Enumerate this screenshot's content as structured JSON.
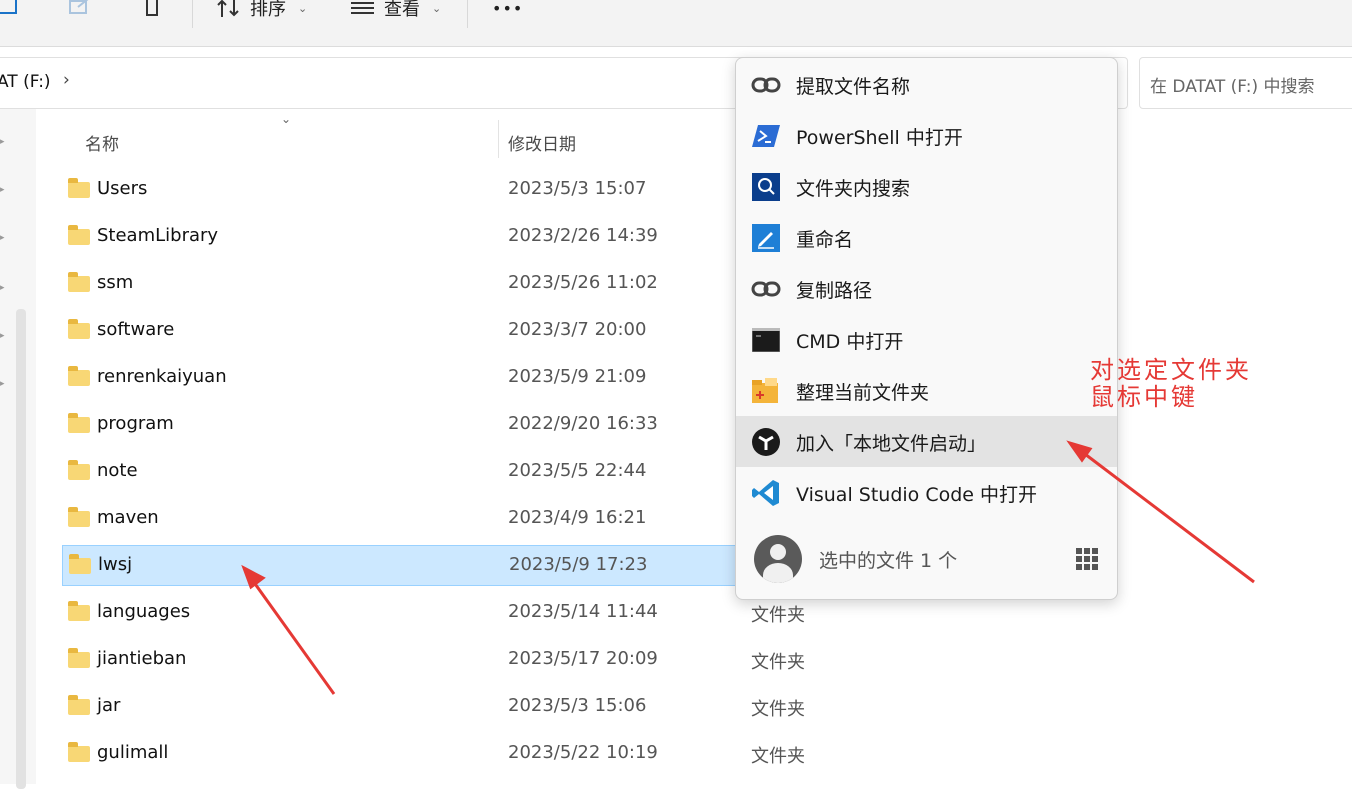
{
  "toolbar": {
    "sort_label": "排序",
    "view_label": "查看",
    "more_label": "•••"
  },
  "address": {
    "path": "AT (F:)",
    "chevron": "›"
  },
  "search": {
    "placeholder": "在 DATAT (F:) 中搜索"
  },
  "columns": {
    "name": "名称",
    "modified": "修改日期"
  },
  "files": [
    {
      "name": "Users",
      "date": "2023/5/3 15:07",
      "type": ""
    },
    {
      "name": "SteamLibrary",
      "date": "2023/2/26 14:39",
      "type": ""
    },
    {
      "name": "ssm",
      "date": "2023/5/26 11:02",
      "type": ""
    },
    {
      "name": "software",
      "date": "2023/3/7 20:00",
      "type": ""
    },
    {
      "name": "renrenkaiyuan",
      "date": "2023/5/9 21:09",
      "type": ""
    },
    {
      "name": "program",
      "date": "2022/9/20 16:33",
      "type": ""
    },
    {
      "name": "note",
      "date": "2023/5/5 22:44",
      "type": ""
    },
    {
      "name": "maven",
      "date": "2023/4/9 16:21",
      "type": ""
    },
    {
      "name": "lwsj",
      "date": "2023/5/9 17:23",
      "type": ""
    },
    {
      "name": "languages",
      "date": "2023/5/14 11:44",
      "type": "文件夹"
    },
    {
      "name": "jiantieban",
      "date": "2023/5/17 20:09",
      "type": "文件夹"
    },
    {
      "name": "jar",
      "date": "2023/5/3 15:06",
      "type": "文件夹"
    },
    {
      "name": "gulimall",
      "date": "2023/5/22 10:19",
      "type": "文件夹"
    }
  ],
  "menu": {
    "items": [
      {
        "label": "提取文件名称",
        "icon": "link-icon"
      },
      {
        "label": "PowerShell 中打开",
        "icon": "powershell-icon"
      },
      {
        "label": "文件夹内搜索",
        "icon": "search-icon"
      },
      {
        "label": "重命名",
        "icon": "rename-pen-icon"
      },
      {
        "label": "复制路径",
        "icon": "link-icon"
      },
      {
        "label": "CMD 中打开",
        "icon": "cmd-icon"
      },
      {
        "label": "整理当前文件夹",
        "icon": "organize-folder-icon"
      },
      {
        "label": "加入「本地文件启动」",
        "icon": "launcher-icon"
      },
      {
        "label": "Visual Studio Code 中打开",
        "icon": "vscode-icon"
      }
    ],
    "footer_text": "选中的文件 1 个"
  },
  "annotation": {
    "line1": "对选定文件夹",
    "line2": "鼠标中键",
    "color": "#e53935"
  },
  "colors": {
    "selection": "#cce8ff",
    "folder": "#f8d775",
    "menu_hover": "#e3e3e3"
  }
}
